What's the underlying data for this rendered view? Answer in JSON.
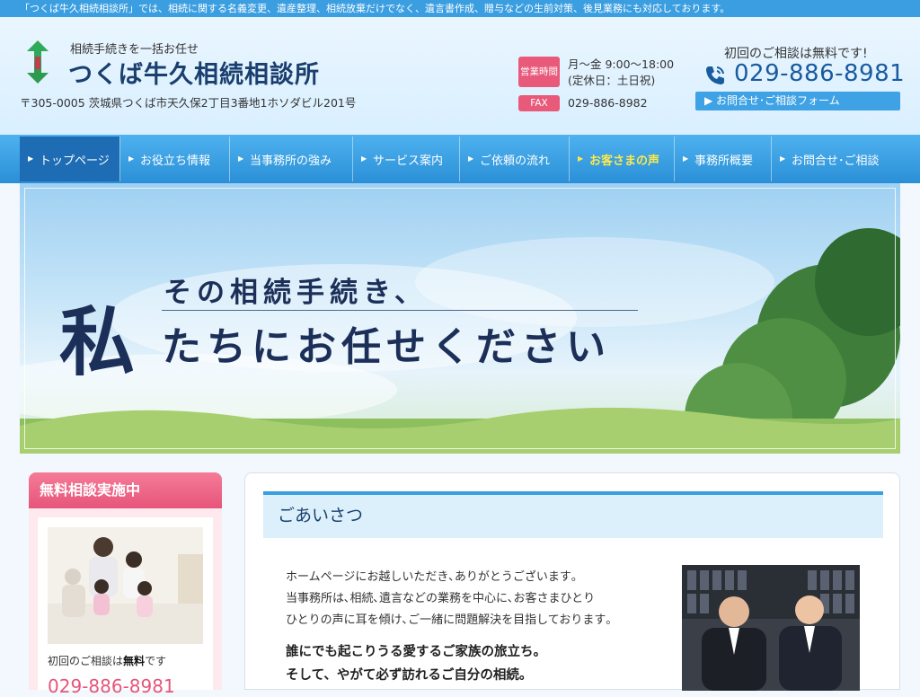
{
  "topbar": {
    "text": "「つくば牛久相続相談所」では、相続に関する名義変更、遺産整理、相続放棄だけでなく、遺言書作成、贈与などの生前対策、後見業務にも対応しております。"
  },
  "header": {
    "tagline": "相続手続きを一括お任せ",
    "site_name": "つくば牛久相続相談所",
    "address": "〒305-0005 茨城県つくば市天久保2丁目3番地1ホソダビル201号",
    "hours_label": "営業時間",
    "hours_line1": "月～金 9:00～18:00",
    "hours_line2": "(定休日：土日祝)",
    "fax_label": "FAX",
    "fax_number": "029-886-8982",
    "free_consult": "初回のご相談は無料です!",
    "phone": "029-886-8981",
    "contact_form": "お問合せ･ご相談フォーム"
  },
  "nav": {
    "items": [
      {
        "label": "トップページ"
      },
      {
        "label": "お役立ち情報"
      },
      {
        "label": "当事務所の強み"
      },
      {
        "label": "サービス案内"
      },
      {
        "label": "ご依頼の流れ"
      },
      {
        "label": "お客さまの声"
      },
      {
        "label": "事務所概要"
      },
      {
        "label": "お問合せ･ご相談"
      }
    ]
  },
  "hero": {
    "line1": "その相続手続き、",
    "big_char": "私",
    "line2": "たちにお任せください"
  },
  "sidebar": {
    "title": "無料相談実施中",
    "note_prefix": "初回のご相談は",
    "note_bold": "無料",
    "note_suffix": "です",
    "phone": "029-886-8981"
  },
  "main": {
    "heading": "ごあいさつ",
    "body_line1": "ホームページにお越しいただき､ありがとうございます｡",
    "body_line2": "当事務所は､相続､遺言などの業務を中心に､お客さまひとり",
    "body_line3": "ひとりの声に耳を傾け､ご一緒に問題解決を目指しております｡",
    "strong_line1": "誰にでも起こりうる愛するご家族の旅立ち。",
    "strong_line2": "そして、やがて必ず訪れるご自分の相続。"
  }
}
